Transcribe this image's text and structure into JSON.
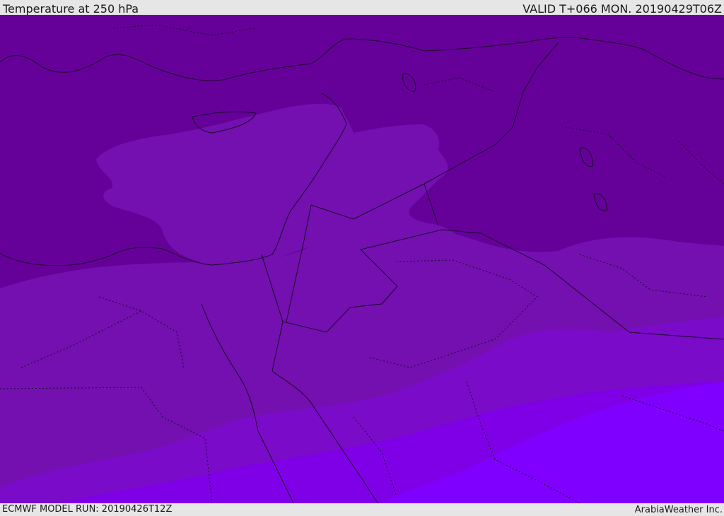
{
  "header": {
    "title": "Temperature at 250 hPa",
    "valid": "VALID T+066 MON. 20190429T06Z"
  },
  "footer": {
    "model_run": "ECMWF MODEL RUN: 20190426T12Z",
    "credit": "ArabiaWeather Inc."
  },
  "map": {
    "field": "temperature-250hpa",
    "colors": {
      "band_coldest": "#650199",
      "band_cold": "#7310AF",
      "band_mid": "#7A0BC8",
      "band_warm": "#7F00E6",
      "band_warmest": "#8000FF",
      "borders": "#1a0a2a"
    }
  }
}
